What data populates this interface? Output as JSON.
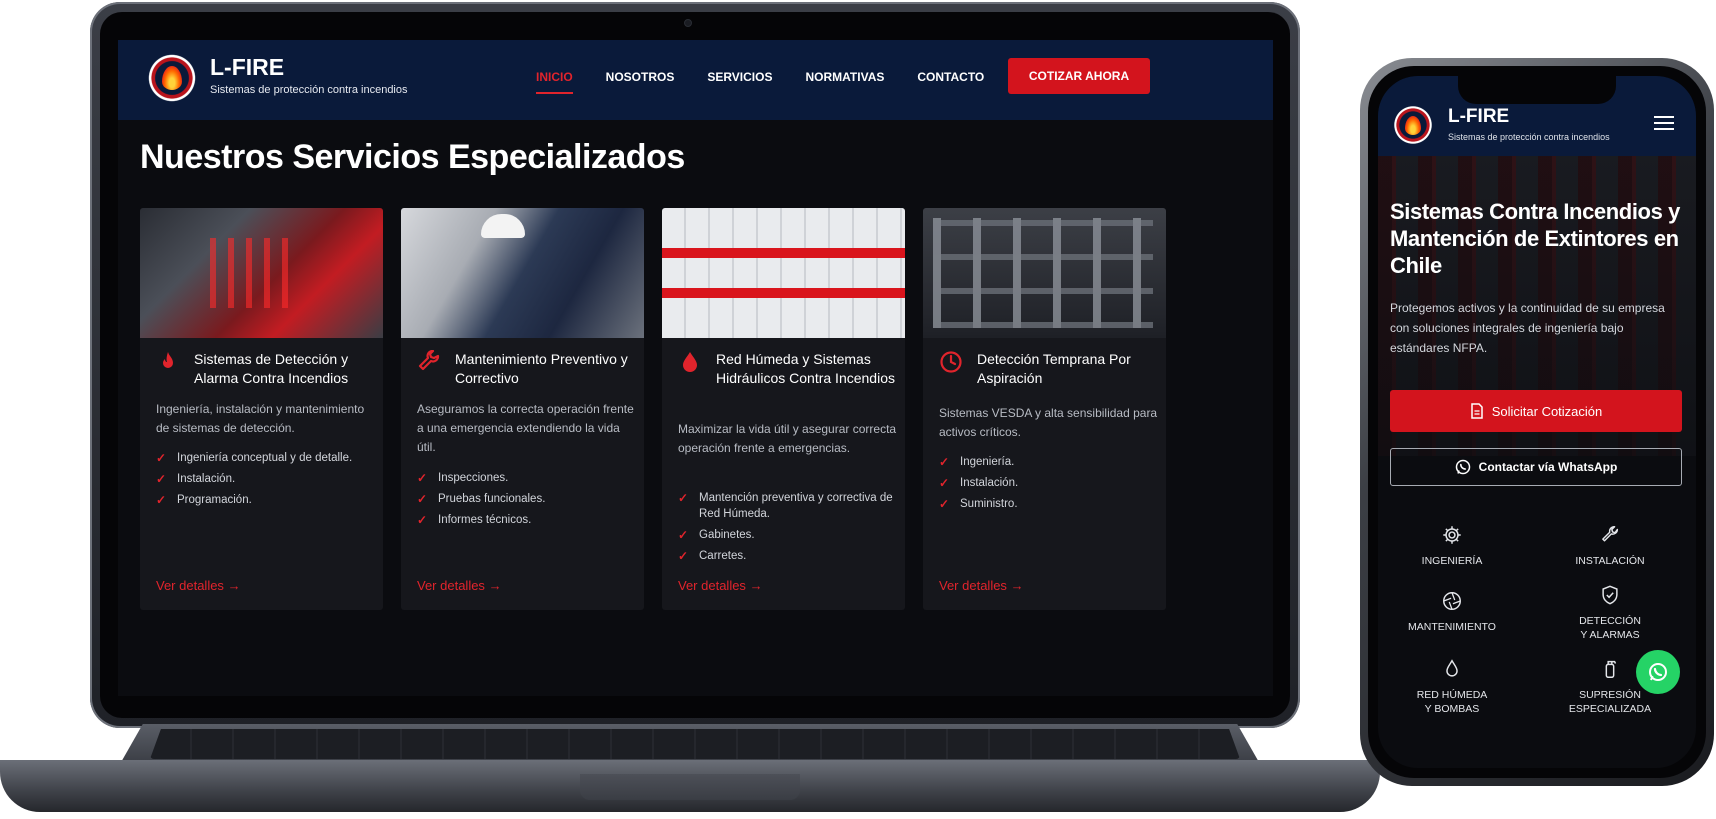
{
  "brand": {
    "name": "L-FIRE",
    "tagline": "Sistemas de protección contra incendios",
    "accent": "#d3141d",
    "navy": "#0a1a3a"
  },
  "nav": {
    "items": [
      {
        "label": "INICIO",
        "active": true
      },
      {
        "label": "NOSOTROS"
      },
      {
        "label": "SERVICIOS"
      },
      {
        "label": "NORMATIVAS"
      },
      {
        "label": "CONTACTO"
      }
    ],
    "cta_label": "COTIZAR AHORA"
  },
  "services": {
    "title": "Nuestros Servicios Especializados",
    "cards": [
      {
        "icon": "flame-icon",
        "title": "Sistemas de Detección y Alarma Contra Incendios",
        "description": "Ingeniería, instalación y mantenimiento de sistemas de detección.",
        "items": [
          "Ingeniería conceptual y de detalle.",
          "Instalación.",
          "Programación."
        ],
        "link": "Ver detalles"
      },
      {
        "icon": "wrench-icon",
        "title": "Mantenimiento Preventivo y Correctivo",
        "description": "Aseguramos la correcta operación frente a una emergencia extendiendo la vida útil.",
        "items": [
          "Inspecciones.",
          "Pruebas funcionales.",
          "Informes técnicos."
        ],
        "link": "Ver detalles"
      },
      {
        "icon": "water-drop-icon",
        "title": "Red Húmeda y Sistemas Hidráulicos Contra Incendios",
        "description": "Maximizar la vida útil y asegurar correcta operación frente a emergencias.",
        "items": [
          "Mantención preventiva y correctiva de Red Húmeda.",
          "Gabinetes.",
          "Carretes."
        ],
        "link": "Ver detalles"
      },
      {
        "icon": "clock-icon",
        "title": "Detección Temprana Por Aspiración",
        "description": "Sistemas VESDA y alta sensibilidad para activos críticos.",
        "items": [
          "Ingeniería.",
          "Instalación.",
          "Suministro."
        ],
        "link": "Ver detalles"
      }
    ]
  },
  "mobile": {
    "hero_title": "Sistemas Contra Incendios y Mantención de Extintores en Chile",
    "hero_text": "Protegemos activos y la continuidad de su empresa con soluciones integrales de ingeniería bajo estándares NFPA.",
    "primary_cta": "Solicitar Cotización",
    "secondary_cta": "Contactar vía WhatsApp",
    "grid": [
      {
        "icon": "gear-icon",
        "label": "INGENIERÍA"
      },
      {
        "icon": "wrench-icon",
        "label": "INSTALACIÓN"
      },
      {
        "icon": "aperture-icon",
        "label": "MANTENIMIENTO"
      },
      {
        "icon": "shield-check-icon",
        "label": "DETECCIÓN\nY ALARMAS"
      },
      {
        "icon": "drop-icon",
        "label": "RED HÚMEDA\nY BOMBAS"
      },
      {
        "icon": "extinguisher-icon",
        "label": "SUPRESIÓN\nESPECIALIZADA"
      }
    ]
  }
}
